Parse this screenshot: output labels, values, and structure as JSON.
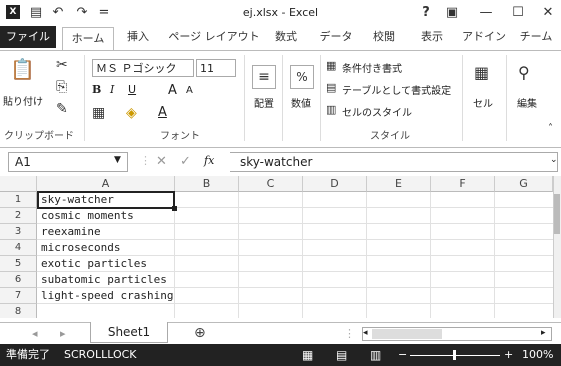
{
  "window": {
    "title": "ej.xlsx - Excel",
    "logo": "X",
    "help": "?",
    "controls": {
      "ribbon_display": "▣",
      "minimize": "—",
      "maximize": "☐",
      "close": "✕"
    }
  },
  "quick_access": {
    "save": "💾",
    "undo": "↶",
    "redo": "↷",
    "customize": "="
  },
  "tabs": [
    "ファイル",
    "ホーム",
    "挿入",
    "ページ レイアウト",
    "数式",
    "データ",
    "校閲",
    "表示",
    "アドイン",
    "チーム"
  ],
  "ribbon": {
    "clipboard": {
      "paste": "貼り付け",
      "label": "クリップボード"
    },
    "font": {
      "name": "ＭＳ Ｐゴシック",
      "size": "11",
      "bold": "B",
      "italic": "I",
      "underline": "U",
      "grow": "A",
      "shrink": "A",
      "label": "フォント"
    },
    "align": {
      "label": "配置"
    },
    "number": {
      "label": "数値",
      "percent": "%"
    },
    "styles": {
      "cond": "条件付き書式",
      "table": "テーブルとして書式設定",
      "cell": "セルのスタイル",
      "label": "スタイル"
    },
    "cells": {
      "label": "セル"
    },
    "edit": {
      "label": "編集"
    }
  },
  "formula_bar": {
    "name_box": "A1",
    "fx": "fx",
    "content": "sky-watcher"
  },
  "grid": {
    "columns": [
      "A",
      "B",
      "C",
      "D",
      "E",
      "F",
      "G"
    ],
    "rows": [
      "1",
      "2",
      "3",
      "4",
      "5",
      "6",
      "7",
      "8"
    ],
    "cells_A": [
      "sky-watcher",
      "cosmic moments",
      "reexamine",
      "microseconds",
      "exotic particles",
      "subatomic particles",
      "light-speed crashing",
      ""
    ]
  },
  "sheet": {
    "name": "Sheet1",
    "add": "⊕"
  },
  "status": {
    "ready": "準備完了",
    "scroll": "SCROLLLOCK",
    "zoom": "100%"
  }
}
